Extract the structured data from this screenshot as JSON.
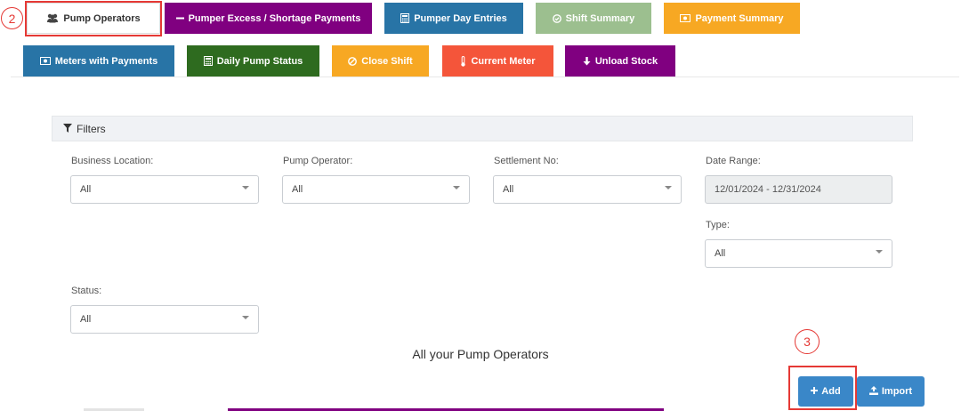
{
  "tabs_row1": [
    {
      "label": "Pump Operators",
      "icon": "users-icon",
      "color": "#ffffff",
      "active": true
    },
    {
      "label": "Pumper Excess / Shortage Payments",
      "icon": "minus-icon",
      "color": "#800080"
    },
    {
      "label": "Pumper Day Entries",
      "icon": "calculator-icon",
      "color": "#2874a6"
    },
    {
      "label": "Shift Summary",
      "icon": "check-circle-icon",
      "color": "#9cbf8f"
    },
    {
      "label": "Payment Summary",
      "icon": "money-icon",
      "color": "#f7a823"
    }
  ],
  "tabs_row2": [
    {
      "label": "Meters with Payments",
      "icon": "money-icon",
      "color": "#2874a6"
    },
    {
      "label": "Daily Pump Status",
      "icon": "calculator-icon",
      "color": "#2e6b1f"
    },
    {
      "label": "Close Shift",
      "icon": "ban-icon",
      "color": "#f7a823"
    },
    {
      "label": "Current Meter",
      "icon": "thermometer-icon",
      "color": "#f4553a"
    },
    {
      "label": "Unload Stock",
      "icon": "arrow-down-icon",
      "color": "#800080"
    }
  ],
  "annotations": {
    "tab_marker": "2",
    "add_marker": "3"
  },
  "filters": {
    "title": "Filters",
    "business_location": {
      "label": "Business Location:",
      "value": "All"
    },
    "pump_operator": {
      "label": "Pump Operator:",
      "value": "All"
    },
    "settlement_no": {
      "label": "Settlement No:",
      "value": "All"
    },
    "date_range": {
      "label": "Date Range:",
      "value": "12/01/2024 - 12/31/2024"
    },
    "type": {
      "label": "Type:",
      "value": "All"
    },
    "status": {
      "label": "Status:",
      "value": "All"
    }
  },
  "section_title": "All your Pump Operators",
  "actions": {
    "add_label": "Add",
    "import_label": "Import"
  }
}
